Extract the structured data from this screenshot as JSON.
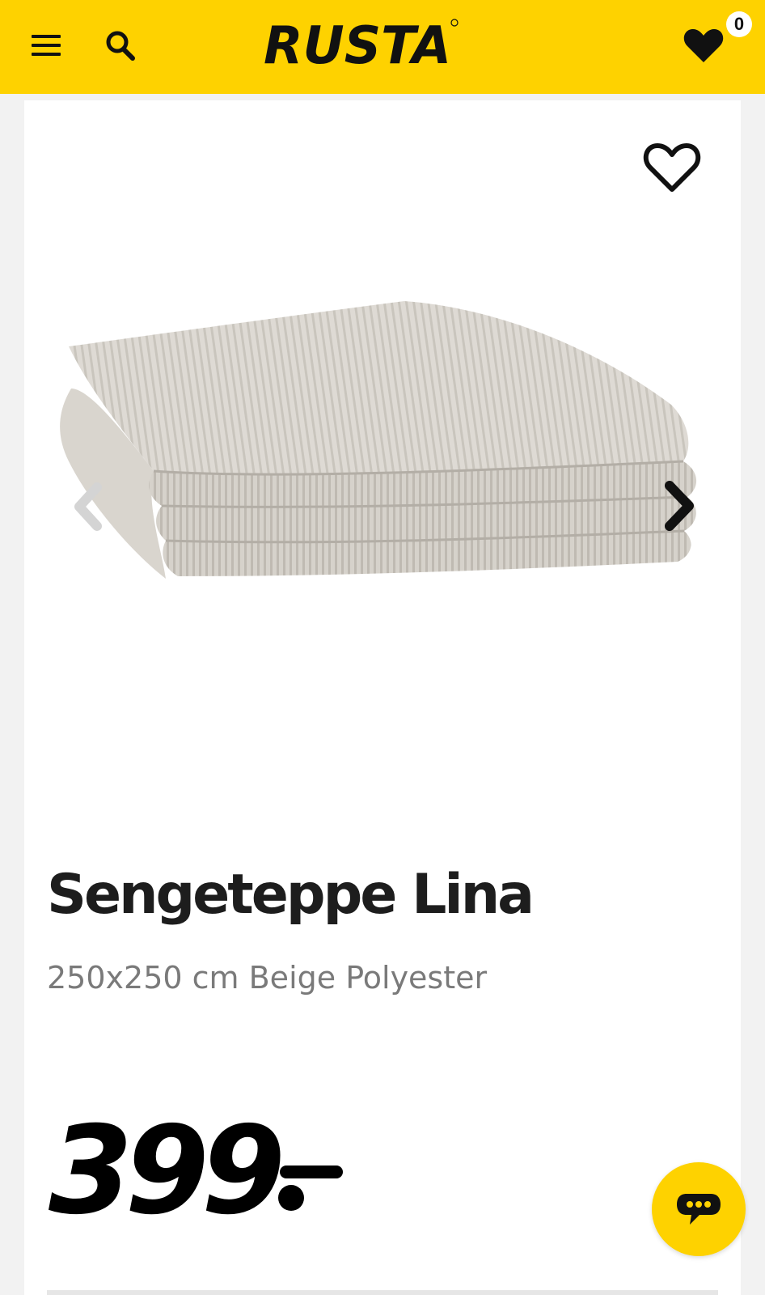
{
  "header": {
    "logo_text": "RUSTA",
    "wishlist_count": "0",
    "background_color": "#fed200"
  },
  "icons": {
    "menu": "hamburger-menu-icon",
    "search": "magnifier-icon",
    "wishlist": "heart-filled-icon",
    "favorite": "heart-outline-icon",
    "prev": "chevron-left-icon",
    "next": "chevron-right-icon",
    "chat": "chat-bubble-icon"
  },
  "product": {
    "title": "Sengeteppe Lina",
    "subtitle": "250x250 cm Beige Polyester",
    "price": "399",
    "image_subject": "folded beige ribbed bedspread"
  }
}
